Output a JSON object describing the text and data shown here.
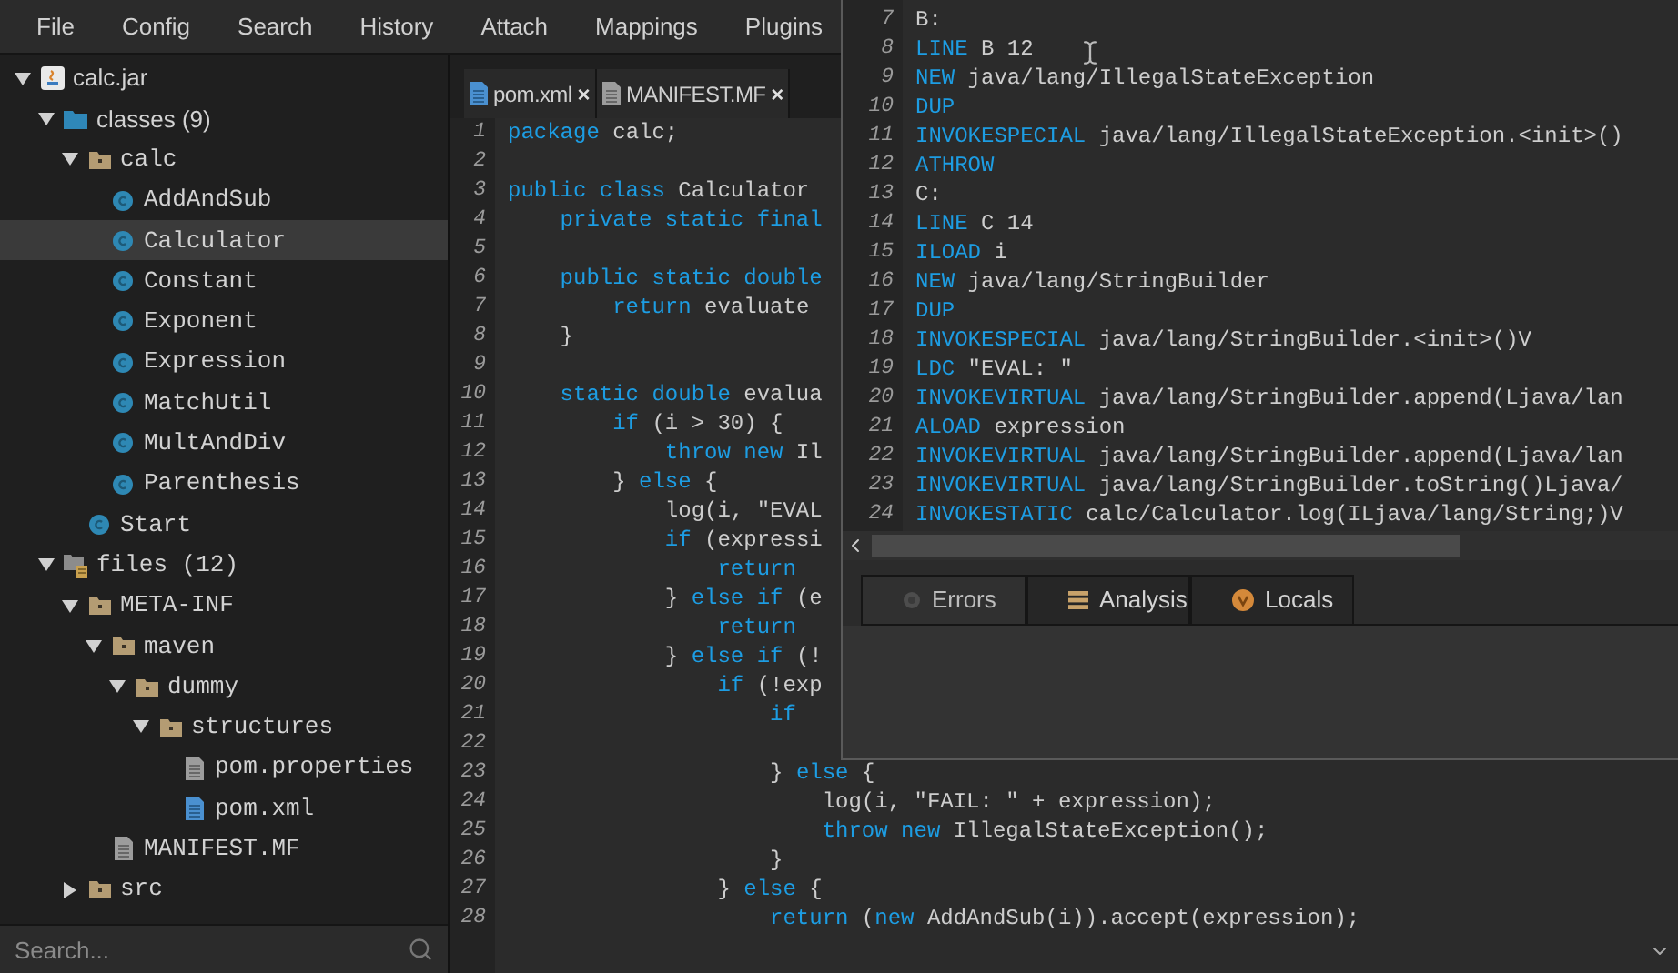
{
  "menu": [
    "File",
    "Config",
    "Search",
    "History",
    "Attach",
    "Mappings",
    "Plugins"
  ],
  "tree": [
    {
      "label": "calc.jar",
      "kind": "jar",
      "expanded": true,
      "selected": false,
      "children": [
        {
          "label": "classes (9)",
          "kind": "classes",
          "expanded": true,
          "selected": false,
          "children": [
            {
              "label": "calc",
              "kind": "package",
              "expanded": true,
              "selected": false,
              "children": [
                {
                  "label": "AddAndSub",
                  "kind": "class",
                  "selected": false
                },
                {
                  "label": "Calculator",
                  "kind": "class",
                  "selected": true
                },
                {
                  "label": "Constant",
                  "kind": "class",
                  "selected": false
                },
                {
                  "label": "Exponent",
                  "kind": "class",
                  "selected": false
                },
                {
                  "label": "Expression",
                  "kind": "class",
                  "selected": false
                },
                {
                  "label": "MatchUtil",
                  "kind": "class",
                  "selected": false
                },
                {
                  "label": "MultAndDiv",
                  "kind": "class",
                  "selected": false
                },
                {
                  "label": "Parenthesis",
                  "kind": "class",
                  "selected": false
                }
              ]
            },
            {
              "label": "Start",
              "kind": "class",
              "selected": false
            }
          ]
        },
        {
          "label": "files (12)",
          "kind": "files",
          "expanded": true,
          "selected": false,
          "children": [
            {
              "label": "META-INF",
              "kind": "package",
              "expanded": true,
              "selected": false,
              "children": [
                {
                  "label": "maven",
                  "kind": "package",
                  "expanded": true,
                  "selected": false,
                  "children": [
                    {
                      "label": "dummy",
                      "kind": "package",
                      "expanded": true,
                      "selected": false,
                      "children": [
                        {
                          "label": "structures",
                          "kind": "package",
                          "expanded": true,
                          "selected": false,
                          "children": [
                            {
                              "label": "pom.properties",
                              "kind": "file",
                              "selected": false
                            },
                            {
                              "label": "pom.xml",
                              "kind": "xml",
                              "selected": false
                            }
                          ]
                        }
                      ]
                    }
                  ]
                },
                {
                  "label": "MANIFEST.MF",
                  "kind": "file",
                  "selected": false
                }
              ]
            },
            {
              "label": "src",
              "kind": "package",
              "expanded": false,
              "selected": false
            }
          ]
        }
      ]
    }
  ],
  "search": {
    "placeholder": "Search..."
  },
  "editor": {
    "tabs": [
      {
        "label": "pom.xml",
        "kind": "xml",
        "close": "×"
      },
      {
        "label": "MANIFEST.MF",
        "kind": "file",
        "close": "×"
      }
    ],
    "lines": [
      {
        "num": "1",
        "tokens": [
          {
            "kind": "keyword",
            "text": "package"
          },
          {
            "kind": "plain",
            "text": " calc;"
          }
        ]
      },
      {
        "num": "2"
      },
      {
        "num": "3",
        "tokens": [
          {
            "kind": "keyword",
            "text": "public class"
          },
          {
            "kind": "plain",
            "text": " Calculator"
          }
        ]
      },
      {
        "num": "4",
        "tokens": [
          {
            "kind": "keyword",
            "text": "    private static final"
          }
        ]
      },
      {
        "num": "5"
      },
      {
        "num": "6",
        "tokens": [
          {
            "kind": "keyword",
            "text": "    public static double"
          }
        ]
      },
      {
        "num": "7",
        "tokens": [
          {
            "kind": "keyword",
            "text": "        return"
          },
          {
            "kind": "plain",
            "text": " evaluate"
          }
        ]
      },
      {
        "num": "8",
        "tokens": [
          {
            "kind": "plain",
            "text": "    }"
          }
        ]
      },
      {
        "num": "9"
      },
      {
        "num": "10",
        "tokens": [
          {
            "kind": "keyword",
            "text": "    static double"
          },
          {
            "kind": "plain",
            "text": " evalua"
          }
        ]
      },
      {
        "num": "11",
        "tokens": [
          {
            "kind": "keyword",
            "text": "        if"
          },
          {
            "kind": "plain",
            "text": " (i > 30) {"
          }
        ]
      },
      {
        "num": "12",
        "tokens": [
          {
            "kind": "keyword",
            "text": "            throw new"
          },
          {
            "kind": "plain",
            "text": " Il"
          }
        ]
      },
      {
        "num": "13",
        "tokens": [
          {
            "kind": "plain",
            "text": "        } "
          },
          {
            "kind": "keyword",
            "text": "else"
          },
          {
            "kind": "plain",
            "text": " {"
          }
        ]
      },
      {
        "num": "14",
        "tokens": [
          {
            "kind": "plain",
            "text": "            log(i, \"EVAL"
          }
        ]
      },
      {
        "num": "15",
        "tokens": [
          {
            "kind": "keyword",
            "text": "            if"
          },
          {
            "kind": "plain",
            "text": " (expressi"
          }
        ]
      },
      {
        "num": "16",
        "tokens": [
          {
            "kind": "keyword",
            "text": "                return"
          }
        ]
      },
      {
        "num": "17",
        "tokens": [
          {
            "kind": "plain",
            "text": "            } "
          },
          {
            "kind": "keyword",
            "text": "else if"
          },
          {
            "kind": "plain",
            "text": " (e"
          }
        ]
      },
      {
        "num": "18",
        "tokens": [
          {
            "kind": "keyword",
            "text": "                return"
          }
        ]
      },
      {
        "num": "19",
        "tokens": [
          {
            "kind": "plain",
            "text": "            } "
          },
          {
            "kind": "keyword",
            "text": "else if"
          },
          {
            "kind": "plain",
            "text": " (!"
          }
        ]
      },
      {
        "num": "20",
        "tokens": [
          {
            "kind": "keyword",
            "text": "                if"
          },
          {
            "kind": "plain",
            "text": " (!exp"
          }
        ]
      },
      {
        "num": "21",
        "tokens": [
          {
            "kind": "keyword",
            "text": "                    if"
          }
        ]
      },
      {
        "num": "22"
      },
      {
        "num": "23",
        "tokens": [
          {
            "kind": "plain",
            "text": "                    } "
          },
          {
            "kind": "keyword",
            "text": "else"
          },
          {
            "kind": "plain",
            "text": " {"
          }
        ]
      },
      {
        "num": "24",
        "tokens": [
          {
            "kind": "plain",
            "text": "                        log(i, \"FAIL: \" + expression);"
          }
        ]
      },
      {
        "num": "25",
        "tokens": [
          {
            "kind": "keyword",
            "text": "                        throw new"
          },
          {
            "kind": "plain",
            "text": " IllegalStateException();"
          }
        ]
      },
      {
        "num": "26",
        "tokens": [
          {
            "kind": "plain",
            "text": "                    }"
          }
        ]
      },
      {
        "num": "27",
        "tokens": [
          {
            "kind": "plain",
            "text": "                } "
          },
          {
            "kind": "keyword",
            "text": "else"
          },
          {
            "kind": "plain",
            "text": " {"
          }
        ]
      },
      {
        "num": "28",
        "tokens": [
          {
            "kind": "keyword",
            "text": "                    return"
          },
          {
            "kind": "plain",
            "text": " ("
          },
          {
            "kind": "keyword",
            "text": "new"
          },
          {
            "kind": "plain",
            "text": " AddAndSub(i)).accept(expression);"
          }
        ]
      }
    ]
  },
  "bytecode_window": {
    "lines": [
      {
        "num": "7",
        "tokens": [
          {
            "kind": "plain",
            "text": "B:"
          }
        ]
      },
      {
        "num": "8",
        "tokens": [
          {
            "kind": "keyword",
            "text": "LINE"
          },
          {
            "kind": "plain",
            "text": " B 12"
          }
        ]
      },
      {
        "num": "9",
        "tokens": [
          {
            "kind": "keyword",
            "text": "NEW"
          },
          {
            "kind": "plain",
            "text": " java/lang/IllegalStateException"
          }
        ]
      },
      {
        "num": "10",
        "tokens": [
          {
            "kind": "keyword",
            "text": "DUP"
          }
        ]
      },
      {
        "num": "11",
        "tokens": [
          {
            "kind": "keyword",
            "text": "INVOKESPECIAL"
          },
          {
            "kind": "plain",
            "text": " java/lang/IllegalStateException.<init>()"
          }
        ]
      },
      {
        "num": "12",
        "tokens": [
          {
            "kind": "keyword",
            "text": "ATHROW"
          }
        ]
      },
      {
        "num": "13",
        "tokens": [
          {
            "kind": "plain",
            "text": "C:"
          }
        ]
      },
      {
        "num": "14",
        "tokens": [
          {
            "kind": "keyword",
            "text": "LINE"
          },
          {
            "kind": "plain",
            "text": " C 14"
          }
        ]
      },
      {
        "num": "15",
        "tokens": [
          {
            "kind": "keyword",
            "text": "ILOAD"
          },
          {
            "kind": "plain",
            "text": " i"
          }
        ]
      },
      {
        "num": "16",
        "tokens": [
          {
            "kind": "keyword",
            "text": "NEW"
          },
          {
            "kind": "plain",
            "text": " java/lang/StringBuilder"
          }
        ]
      },
      {
        "num": "17",
        "tokens": [
          {
            "kind": "keyword",
            "text": "DUP"
          }
        ]
      },
      {
        "num": "18",
        "tokens": [
          {
            "kind": "keyword",
            "text": "INVOKESPECIAL"
          },
          {
            "kind": "plain",
            "text": " java/lang/StringBuilder.<init>()V"
          }
        ]
      },
      {
        "num": "19",
        "tokens": [
          {
            "kind": "keyword",
            "text": "LDC"
          },
          {
            "kind": "plain",
            "text": " \"EVAL: \""
          }
        ]
      },
      {
        "num": "20",
        "tokens": [
          {
            "kind": "keyword",
            "text": "INVOKEVIRTUAL"
          },
          {
            "kind": "plain",
            "text": " java/lang/StringBuilder.append(Ljava/lan"
          }
        ]
      },
      {
        "num": "21",
        "tokens": [
          {
            "kind": "keyword",
            "text": "ALOAD"
          },
          {
            "kind": "plain",
            "text": " expression"
          }
        ]
      },
      {
        "num": "22",
        "tokens": [
          {
            "kind": "keyword",
            "text": "INVOKEVIRTUAL"
          },
          {
            "kind": "plain",
            "text": " java/lang/StringBuilder.append(Ljava/lan"
          }
        ]
      },
      {
        "num": "23",
        "tokens": [
          {
            "kind": "keyword",
            "text": "INVOKEVIRTUAL"
          },
          {
            "kind": "plain",
            "text": " java/lang/StringBuilder.toString()Ljava/"
          }
        ]
      },
      {
        "num": "24",
        "tokens": [
          {
            "kind": "keyword",
            "text": "INVOKESTATIC"
          },
          {
            "kind": "plain",
            "text": " calc/Calculator.log(ILjava/lang/String;)V"
          }
        ]
      }
    ],
    "panel_tabs": [
      {
        "label": "Errors",
        "kind": "errors",
        "selected": true
      },
      {
        "label": "Analysis",
        "kind": "analysis",
        "selected": false
      },
      {
        "label": "Locals",
        "kind": "locals",
        "selected": false
      }
    ]
  }
}
